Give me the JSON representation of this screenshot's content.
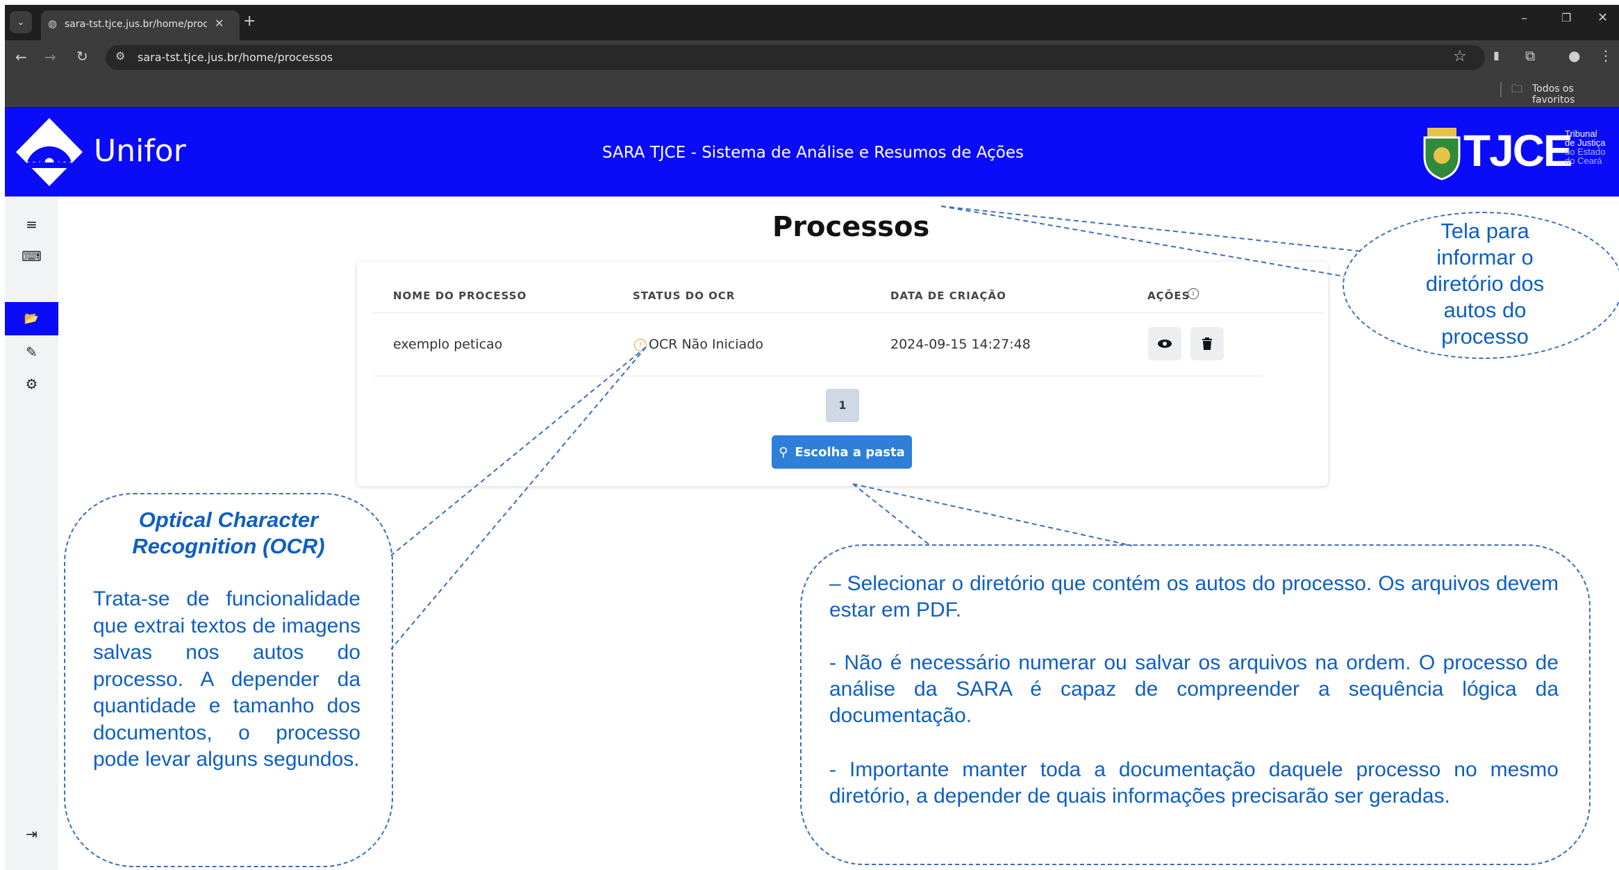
{
  "browser": {
    "tab_title": "sara-tst.tjce.jus.br/home/proces",
    "url": "sara-tst.tjce.jus.br/home/processos",
    "bookmarks_label": "Todos os favoritos"
  },
  "header": {
    "brand": "Unifor",
    "system_title": "SARA TJCE - Sistema de Análise e Resumos de Ações",
    "tjce_logo": "TJCE",
    "tjce_sub": [
      "Tribunal",
      "de Justiça",
      "do Estado",
      "do Ceará"
    ]
  },
  "sidebar": {
    "items": [
      {
        "icon": "menu-icon",
        "glyph": "≡",
        "active": false
      },
      {
        "icon": "keyboard-icon",
        "glyph": "⌨",
        "active": false
      },
      {
        "icon": "folder-open-icon",
        "glyph": "📂",
        "active": true
      },
      {
        "icon": "edit-document-icon",
        "glyph": "✎",
        "active": false
      },
      {
        "icon": "gear-icon",
        "glyph": "⚙",
        "active": false
      }
    ],
    "logout_glyph": "⇥"
  },
  "main": {
    "page_title": "Processos",
    "table": {
      "columns": [
        "NOME DO PROCESSO",
        "STATUS DO OCR",
        "DATA DE CRIAÇÃO",
        "AÇÕES"
      ],
      "rows": [
        {
          "name": "exemplo peticao",
          "ocr_status": "OCR Não Iniciado",
          "created": "2024-09-15 14:27:48"
        }
      ]
    },
    "pagination": {
      "current_page": "1"
    },
    "choose_folder_label": "Escolha a pasta"
  },
  "annotations": {
    "top_right": "Tela para informar o diretório dos autos do processo",
    "left_title": "Optical Character Recognition (OCR)",
    "left_body": "Trata-se de funcionalidade que extrai textos de imagens salvas nos autos do processo. A depender da quantidade e tamanho dos documentos, o processo pode levar alguns segundos.",
    "right_p1": "– Selecionar o diretório que contém os autos do processo. Os arquivos devem estar em PDF.",
    "right_p2": "- Não é necessário numerar ou salvar os arquivos na ordem. O processo de análise da SARA é capaz de compreender a sequência lógica da documentação.",
    "right_p3": "- Importante manter toda a documentação daquele processo no mesmo diretório, a depender de quais informações precisarão ser geradas."
  },
  "colors": {
    "header_blue": "#0a0bf9",
    "button_blue": "#2f7fd8",
    "annotation_blue": "#0e5fc2"
  }
}
